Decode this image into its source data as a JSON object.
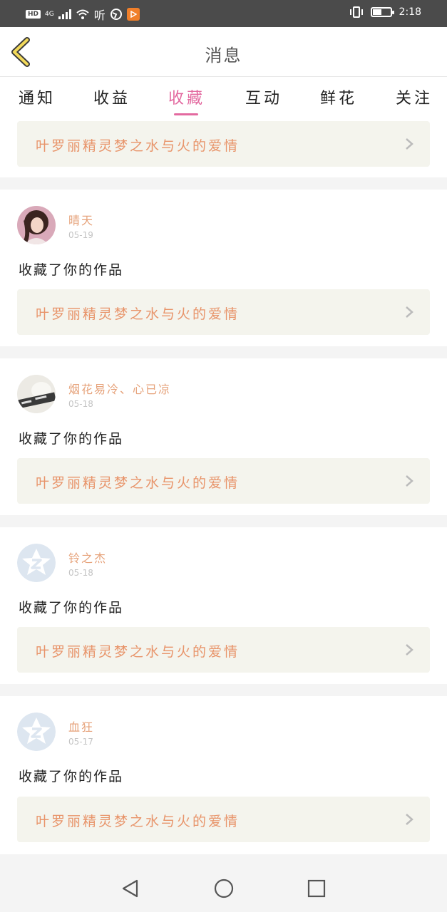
{
  "status_bar": {
    "hd": "HD",
    "network": "4G",
    "ting": "听",
    "time": "2:18"
  },
  "header": {
    "title": "消息"
  },
  "tabs": [
    {
      "label": "通知"
    },
    {
      "label": "收益"
    },
    {
      "label": "收藏"
    },
    {
      "label": "互动"
    },
    {
      "label": "鲜花"
    },
    {
      "label": "关注"
    }
  ],
  "active_tab": "收藏",
  "feed": {
    "top_partial": {
      "work_title": "叶罗丽精灵梦之水与火的爱情"
    },
    "items": [
      {
        "user": "晴天",
        "date": "05-19",
        "action": "收藏了你的作品",
        "work_title": "叶罗丽精灵梦之水与火的爱情",
        "avatar": "photo-girl"
      },
      {
        "user": "烟花易冷、心已凉",
        "date": "05-18",
        "action": "收藏了你的作品",
        "work_title": "叶罗丽精灵梦之水与火的爱情",
        "avatar": "photo-text"
      },
      {
        "user": "铃之杰",
        "date": "05-18",
        "action": "收藏了你的作品",
        "work_title": "叶罗丽精灵梦之水与火的爱情",
        "avatar": "default-z"
      },
      {
        "user": "血狂",
        "date": "05-17",
        "action": "收藏了你的作品",
        "work_title": "叶罗丽精灵梦之水与火的爱情",
        "avatar": "default-z"
      }
    ]
  },
  "icons": {
    "back": "chevron-left-icon",
    "chevron": "chevron-right-icon",
    "nav_back": "triangle-back-icon",
    "nav_home": "circle-home-icon",
    "nav_recent": "square-recent-icon"
  },
  "colors": {
    "accent": "#e36aa0",
    "username": "#e6a27a",
    "work_title": "#e8946a",
    "back_arrow": "#f2d95a"
  }
}
